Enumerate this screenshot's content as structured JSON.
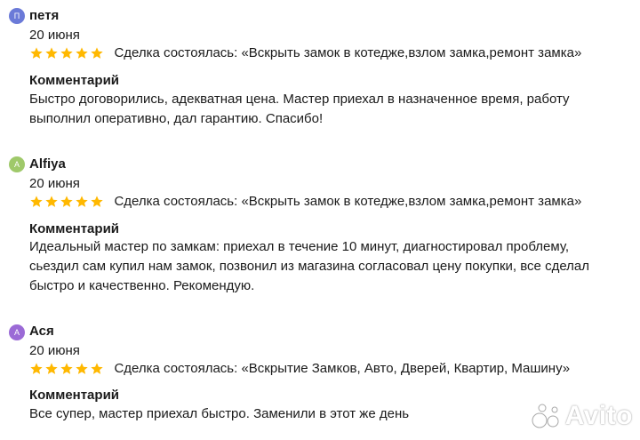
{
  "colors": {
    "star": "#ffb800",
    "avatar_1": "#6b7ad8",
    "avatar_2": "#9fc96a",
    "avatar_3": "#9b6ad6"
  },
  "reviews": [
    {
      "avatar_letter": "П",
      "name": "петя",
      "date": "20 июня",
      "rating": 5,
      "deal": "Сделка состоялась: «Вскрыть замок в котедже,взлом замка,ремонт замка»",
      "comment_label": "Комментарий",
      "comment_lines": [
        "Быстро договорились, адекватная цена. Мастер приехал в назначенное время, работу",
        "выполнил оперативно, дал гарантию. Спасибо!"
      ]
    },
    {
      "avatar_letter": "A",
      "name": "Alfiya",
      "date": "20 июня",
      "rating": 5,
      "deal": "Сделка состоялась: «Вскрыть замок в котедже,взлом замка,ремонт замка»",
      "comment_label": "Комментарий",
      "comment_lines": [
        "Идеальный мастер по замкам: приехал в течение 10 минут, диагностировал проблему,",
        "сьездил сам купил нам замок, позвонил из магазина согласовал цену покупки, все сделал",
        "быстро и качественно. Рекомендую."
      ]
    },
    {
      "avatar_letter": "А",
      "name": "Ася",
      "date": "20 июня",
      "rating": 5,
      "deal": "Сделка состоялась: «Вскрытие Замков, Авто, Дверей, Квартир, Машину»",
      "comment_label": "Комментарий",
      "comment_lines": [
        "Все супер, мастер приехал быстро. Заменили в этот же день"
      ]
    }
  ],
  "watermark": {
    "text": "Avito",
    "icon": "avito-dots-icon"
  }
}
